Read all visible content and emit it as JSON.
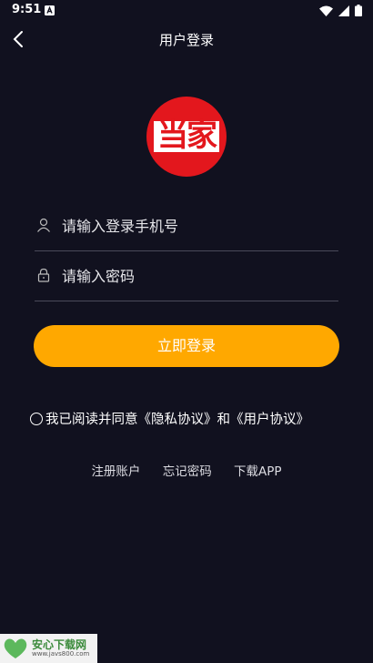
{
  "status_bar": {
    "time": "9:51"
  },
  "header": {
    "title": "用户登录"
  },
  "logo": {
    "text": "当家",
    "color": "#e3171d"
  },
  "form": {
    "phone_placeholder": "请输入登录手机号",
    "password_placeholder": "请输入密码"
  },
  "login_button": {
    "label": "立即登录",
    "color": "#ffa800"
  },
  "agreement": {
    "text": "我已阅读并同意《隐私协议》和《用户协议》"
  },
  "links": [
    {
      "label": "注册账户"
    },
    {
      "label": "忘记密码"
    },
    {
      "label": "下载APP"
    }
  ],
  "watermark": {
    "title": "安心下载网",
    "url": "www.javs800.com"
  }
}
